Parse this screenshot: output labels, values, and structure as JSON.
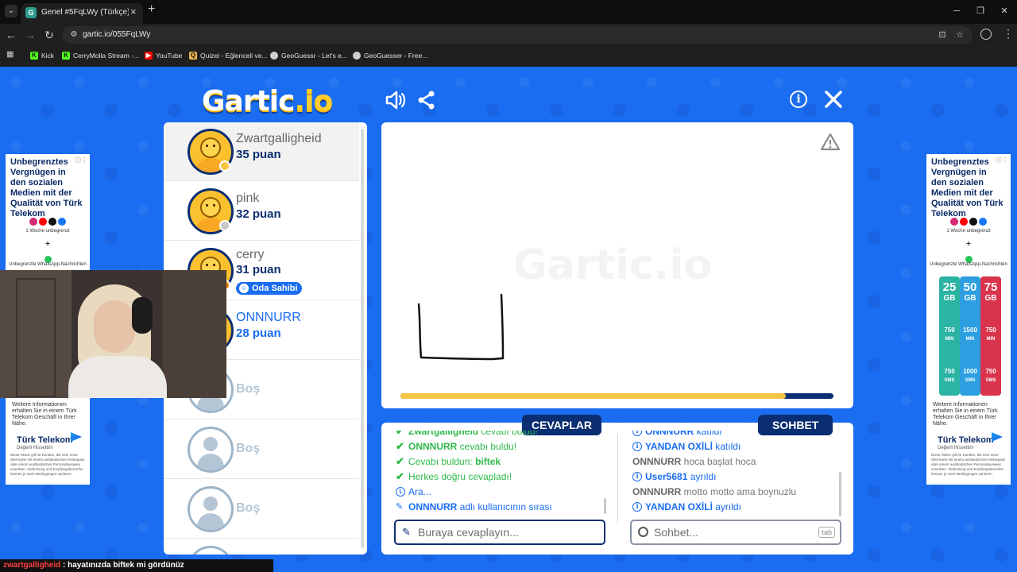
{
  "browser": {
    "tab_title": "Genel #5FqLWy (Türkçe) - Gartic",
    "tab_favicon": "G",
    "url": "gartic.io/055FqLWy",
    "bookmarks": [
      "Kick",
      "CerryMolla Stream -...",
      "YouTube",
      "Quizei - Eğlenceli ve...",
      "GeoGuessr - Let's e...",
      "GeoGuesser - Free..."
    ]
  },
  "game": {
    "logo_main": "Gartic",
    "logo_suffix": ".io",
    "players": [
      {
        "name": "Zwartgalligheid",
        "score": "35 puan",
        "status_color": "#f6c445"
      },
      {
        "name": "pink",
        "score": "32 puan",
        "status_color": "#c9c9c9"
      },
      {
        "name": "cerry",
        "score": "31 puan",
        "status_color": "#f57c00",
        "badge": "Oda Sahibi"
      },
      {
        "name": "ONNNURR",
        "score": "28 puan"
      }
    ],
    "empty_slot_label": "Boş",
    "empty_slots": [
      "Boş",
      "Boş",
      "Boş"
    ],
    "timer_fraction": 0.89,
    "watermark": "Gartic.io"
  },
  "answers": {
    "tab_label": "CEVAPLAR",
    "messages": [
      {
        "icon": "check",
        "parts": [
          {
            "t": "Zwartgalligheid",
            "c": "gb"
          },
          {
            "t": " cevabı buldu!",
            "c": "g"
          }
        ]
      },
      {
        "icon": "check",
        "parts": [
          {
            "t": "ONNNURR",
            "c": "gb"
          },
          {
            "t": " cevabı buldu!",
            "c": "g"
          }
        ]
      },
      {
        "icon": "check",
        "parts": [
          {
            "t": "Cevabı buldun: ",
            "c": "g"
          },
          {
            "t": "biftek",
            "c": "gb"
          }
        ]
      },
      {
        "icon": "check",
        "parts": [
          {
            "t": "Herkes doğru cevapladı!",
            "c": "g"
          }
        ]
      },
      {
        "icon": "clock",
        "parts": [
          {
            "t": "Ara...",
            "c": "b"
          }
        ]
      },
      {
        "icon": "pencil",
        "parts": [
          {
            "t": "ONNNURR",
            "c": "bb"
          },
          {
            "t": " adlı kullanıcının sırası",
            "c": "b"
          }
        ]
      }
    ],
    "placeholder": "Buraya cevaplayın..."
  },
  "chat": {
    "tab_label": "SOHBET",
    "messages": [
      {
        "icon": "info",
        "parts": [
          {
            "t": "ONNNURR",
            "c": "bb"
          },
          {
            "t": " katıldı",
            "c": "b"
          }
        ]
      },
      {
        "icon": "info",
        "parts": [
          {
            "t": "YANDAN OXİLİ",
            "c": "bb"
          },
          {
            "t": " katıldı",
            "c": "b"
          }
        ]
      },
      {
        "icon": "none",
        "parts": [
          {
            "t": "ONNNURR",
            "c": "grayb"
          },
          {
            "t": " hoca başlat hoca",
            "c": "gray"
          }
        ]
      },
      {
        "icon": "info",
        "parts": [
          {
            "t": "User5681",
            "c": "bb"
          },
          {
            "t": " ayrıldı",
            "c": "b"
          }
        ]
      },
      {
        "icon": "none",
        "parts": [
          {
            "t": "ONNNURR",
            "c": "grayb"
          },
          {
            "t": " motto motto ama boynuzlu",
            "c": "gray"
          }
        ]
      },
      {
        "icon": "info",
        "parts": [
          {
            "t": "YANDAN OXİLİ",
            "c": "bb"
          },
          {
            "t": " ayrıldı",
            "c": "b"
          }
        ]
      }
    ],
    "placeholder": "Sohbet...",
    "tab_key": "tab"
  },
  "ads": {
    "headline": "Unbegrenztes Vergnügen in den sozialen Medien mit der Qualität von Türk Telekom",
    "week": "1 Woche unbegrenzt",
    "plus": "+",
    "whatsapp": "Unbegrenzte WhatsApp-Nachrichten",
    "plans": [
      {
        "gb": "25",
        "min": "750",
        "sms": "750",
        "color": "#2bb3a3"
      },
      {
        "gb": "50",
        "min": "1500",
        "sms": "1000",
        "color": "#2d9fe0"
      },
      {
        "gb": "75",
        "min": "750",
        "sms": "750",
        "color": "#d9344b"
      }
    ],
    "unit_gb": "GB",
    "unit_min": "MIN",
    "unit_sms": "SMS",
    "info": "Weitere Informationen erhalten Sie in einem Türk Telekom Geschäft in Ihrer Nähe.",
    "brand": "Türk Telekom",
    "brand_sub": "Değerli Hissettirir",
    "fine_print": "Diese Aktion gilt für Kunden, die eine neue SIM-Karte mit einem ausländischen Reisepass oder einem ausländischen Personalausweis erwerben. Abdeckung und Empfangsbereiche können je nach Bedingungen variieren"
  },
  "ticker": {
    "user": "zwartgalligheid",
    "text": " : hayatınızda biftek mi gördünüz"
  }
}
